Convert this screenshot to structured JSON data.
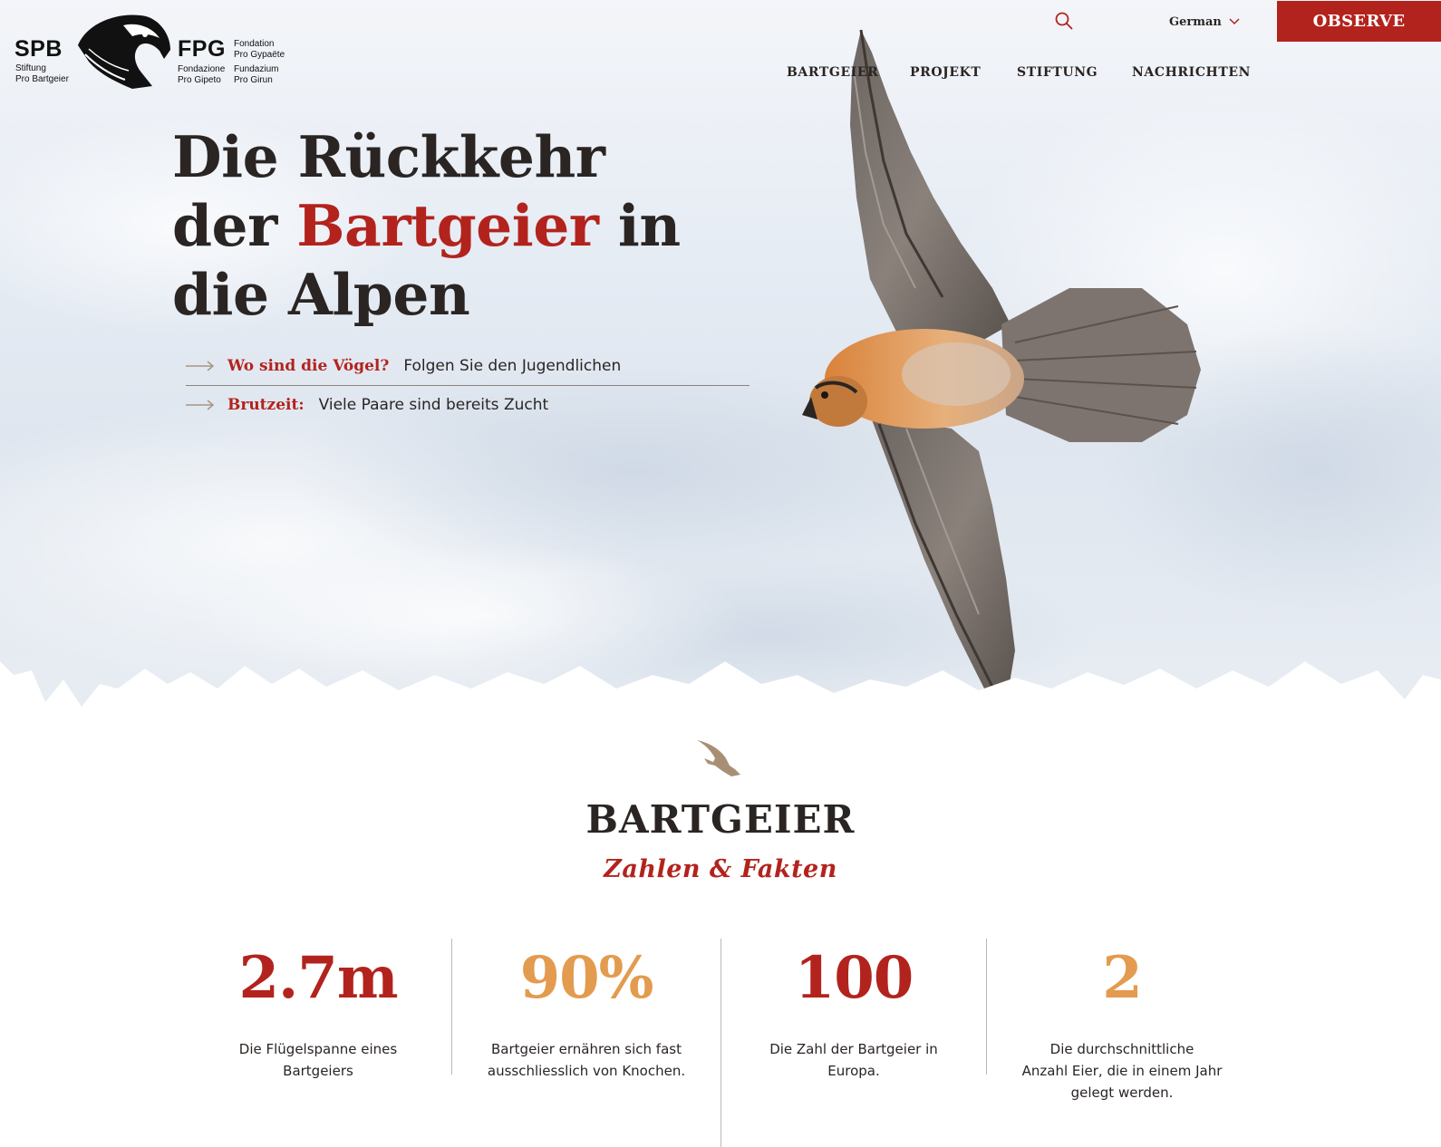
{
  "logo": {
    "left_abbr": "SPB",
    "left_line1": "Stiftung",
    "left_line2": "Pro Bartgeier",
    "right_abbr": "FPG",
    "right_top1": "Fondation",
    "right_top2": "Pro Gypaëte",
    "right_bottom_a1": "Fondazione",
    "right_bottom_a2": "Pro Gipeto",
    "right_bottom_b1": "Fundazium",
    "right_bottom_b2": "Pro Girun"
  },
  "header": {
    "language": "German",
    "cta": "OBSERVE",
    "icons": [
      "search-icon",
      "chevron-down-icon"
    ]
  },
  "nav": {
    "items": [
      "BARTGEIER",
      "PROJEKT",
      "STIFTUNG",
      "NACHRICHTEN"
    ]
  },
  "hero": {
    "headline_part1": "Die Rückkehr",
    "headline_part2": "der ",
    "headline_accent": "Bartgeier",
    "headline_part3": " in",
    "headline_part4": "die Alpen",
    "links": [
      {
        "label": "Wo sind die Vögel?",
        "text": "Folgen Sie den Jugendlichen"
      },
      {
        "label": "Brutzeit:",
        "text": "Viele Paare sind bereits Zucht"
      }
    ]
  },
  "facts": {
    "title": "BARTGEIER",
    "subtitle": "Zahlen & Fakten",
    "stats": [
      {
        "value": "2.7m",
        "color": "#b3231d",
        "desc_line1": "Die Flügelspanne eines",
        "desc_line2": "Bartgeiers",
        "desc_line3": ""
      },
      {
        "value": "90%",
        "color": "#e39b4f",
        "desc_line1": "Bartgeier ernähren sich fast",
        "desc_line2": "ausschliesslich von Knochen.",
        "desc_line3": ""
      },
      {
        "value": "100",
        "color": "#b3231d",
        "desc_line1": "Die Zahl der Bartgeier in",
        "desc_line2": "Europa.",
        "desc_line3": ""
      },
      {
        "value": "2",
        "color": "#e39b4f",
        "desc_line1": "Die durchschnittliche",
        "desc_line2": "Anzahl Eier, die in einem Jahr",
        "desc_line3": "gelegt werden."
      }
    ]
  },
  "colors": {
    "accent_red": "#b3231d",
    "accent_orange": "#e39b4f",
    "text_dark": "#2a2523"
  }
}
